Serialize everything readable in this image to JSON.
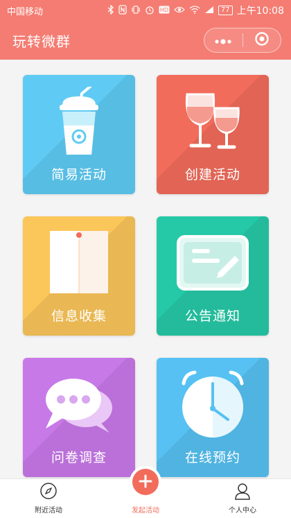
{
  "status_bar": {
    "carrier": "中国移动",
    "battery": "77",
    "time": "上午10:08"
  },
  "nav": {
    "title": "玩转微群",
    "more_icon": "more-dots-icon",
    "close_icon": "target-close-icon"
  },
  "cards": [
    {
      "label": "简易活动",
      "color": "#5fcbf4",
      "icon": "drink-cup-icon"
    },
    {
      "label": "创建活动",
      "color": "#f26c5b",
      "icon": "wine-glasses-icon"
    },
    {
      "label": "信息收集",
      "color": "#fbc65a",
      "icon": "document-folder-icon"
    },
    {
      "label": "公告通知",
      "color": "#26c9a7",
      "icon": "notice-board-icon"
    },
    {
      "label": "问卷调查",
      "color": "#c879e8",
      "icon": "chat-bubbles-icon"
    },
    {
      "label": "在线预约",
      "color": "#56c1f2",
      "icon": "alarm-clock-icon"
    }
  ],
  "tab_bar": {
    "items": [
      {
        "label": "附近活动",
        "icon": "compass-icon"
      },
      {
        "label": "发起活动",
        "icon": "plus-icon",
        "active_color": "#f26c5b"
      },
      {
        "label": "个人中心",
        "icon": "user-icon"
      }
    ]
  }
}
